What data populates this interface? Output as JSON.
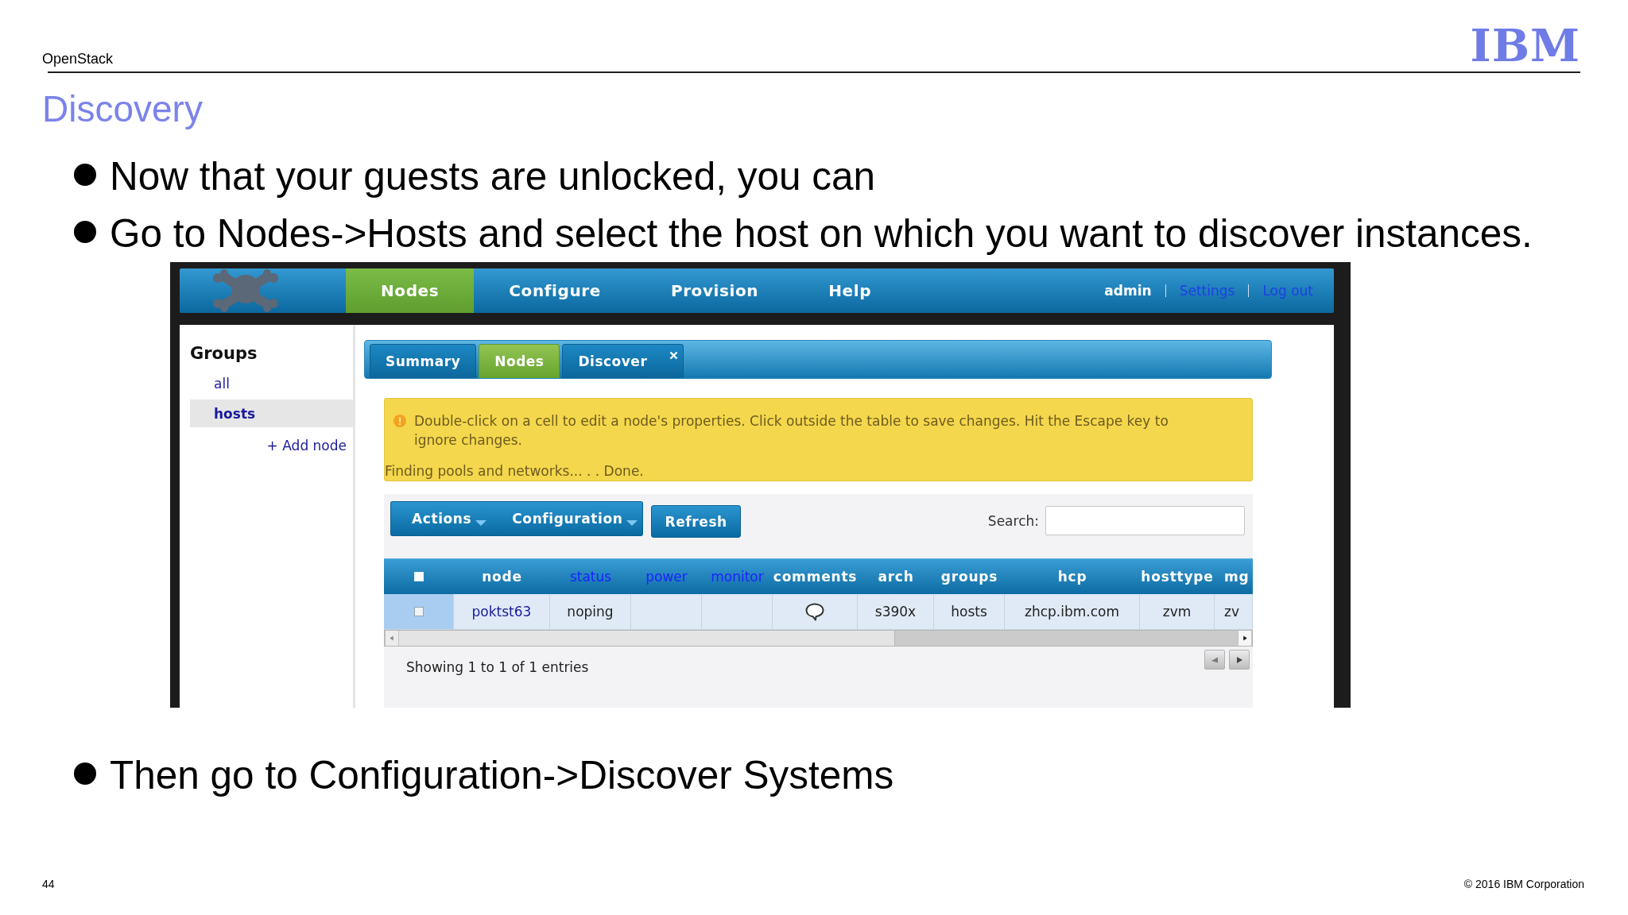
{
  "slide": {
    "section": "OpenStack",
    "logo": "IBM",
    "title": "Discovery"
  },
  "bullets": [
    "Now that your guests are unlocked, you can",
    "Go to Nodes->Hosts and select the host on which you want to discover instances."
  ],
  "screenshot": {
    "nav": {
      "tabs": [
        {
          "label": "Nodes",
          "selected": true
        },
        {
          "label": "Configure",
          "selected": false
        },
        {
          "label": "Provision",
          "selected": false
        },
        {
          "label": "Help",
          "selected": false
        }
      ],
      "user": "admin",
      "links": [
        "Settings",
        "Log out"
      ]
    },
    "sidebar": {
      "title": "Groups",
      "items": [
        {
          "label": "all",
          "selected": false
        },
        {
          "label": "hosts",
          "selected": true
        }
      ],
      "add_link": "+ Add node"
    },
    "tabs": [
      {
        "label": "Summary",
        "selected": false,
        "closable": false
      },
      {
        "label": "Nodes",
        "selected": true,
        "closable": false
      },
      {
        "label": "Discover",
        "selected": false,
        "closable": true
      }
    ],
    "alert": {
      "message": "Double-click on a cell to edit a node's properties. Click outside the table to save changes. Hit the Escape key to ignore changes.",
      "status": "Finding pools and networks... . . Done."
    },
    "toolbar": {
      "menus": [
        "Actions",
        "Configuration"
      ],
      "button": "Refresh",
      "search_label": "Search:"
    },
    "table": {
      "select_all": {
        "checked": false
      },
      "columns": [
        {
          "label": "node",
          "kind": "label"
        },
        {
          "label": "status",
          "kind": "link"
        },
        {
          "label": "power",
          "kind": "link"
        },
        {
          "label": "monitor",
          "kind": "link"
        },
        {
          "label": "comments",
          "kind": "label"
        },
        {
          "label": "arch",
          "kind": "label"
        },
        {
          "label": "groups",
          "kind": "label"
        },
        {
          "label": "hcp",
          "kind": "label"
        },
        {
          "label": "hosttype",
          "kind": "label"
        },
        {
          "label": "mg",
          "kind": "label"
        }
      ],
      "rows": [
        {
          "checked": false,
          "cells": [
            {
              "kind": "link",
              "text": "poktst63"
            },
            {
              "kind": "text",
              "text": "noping"
            },
            {
              "kind": "empty"
            },
            {
              "kind": "empty"
            },
            {
              "kind": "comment"
            },
            {
              "kind": "text",
              "text": "s390x"
            },
            {
              "kind": "text",
              "text": "hosts"
            },
            {
              "kind": "text",
              "text": "zhcp.ibm.com"
            },
            {
              "kind": "text",
              "text": "zvm"
            },
            {
              "kind": "text",
              "text": "zv"
            }
          ]
        }
      ],
      "info": "Showing 1 to 1 of 1 entries"
    }
  },
  "bullets_after": [
    "Then go to Configuration->Discover Systems"
  ],
  "footer": {
    "page": "44",
    "copyright": "© 2016 IBM Corporation"
  }
}
